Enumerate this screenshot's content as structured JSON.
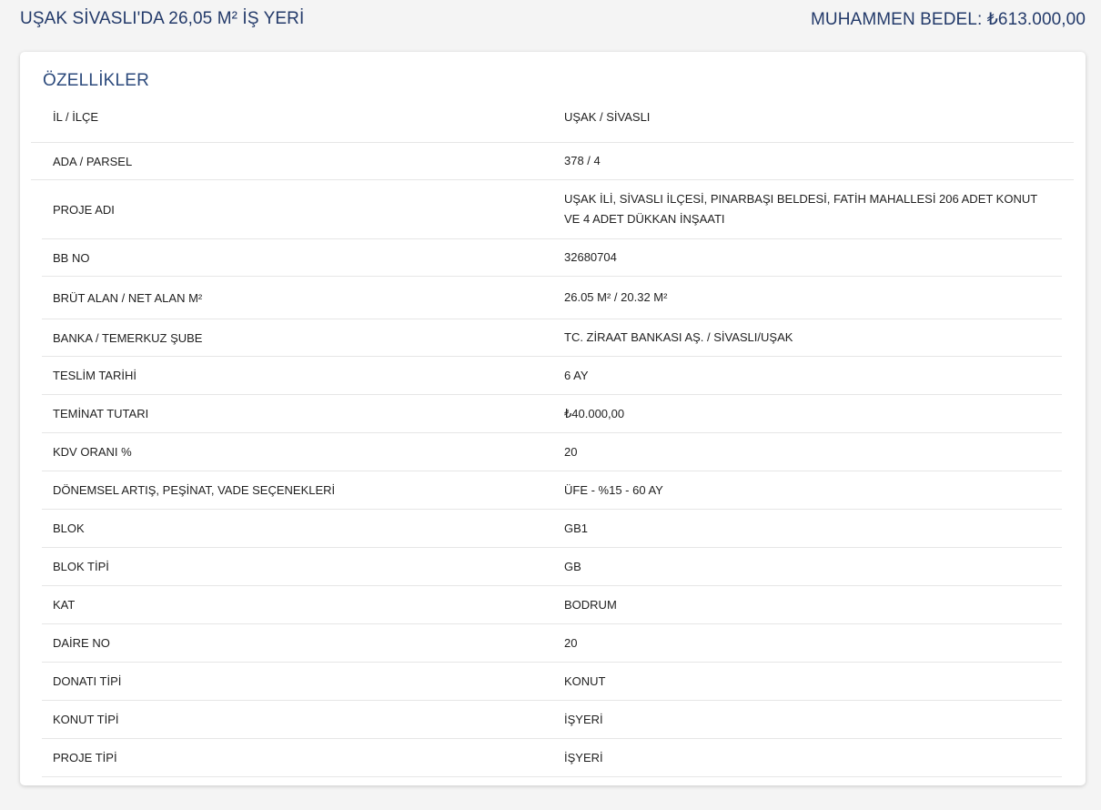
{
  "header": {
    "title": "UŞAK SİVASLI'DA 26,05 M² İŞ YERİ",
    "price": "MUHAMMEN BEDEL: ₺613.000,00"
  },
  "section": {
    "title": "ÖZELLİKLER"
  },
  "properties": [
    {
      "label": "İL / İLÇE",
      "value": "UŞAK / SİVASLI"
    },
    {
      "label": "ADA / PARSEL",
      "value": "378 / 4"
    },
    {
      "label": "PROJE ADI",
      "value": "UŞAK İLİ, SİVASLI İLÇESİ, PINARBAŞI BELDESİ, FATİH MAHALLESİ 206 ADET KONUT VE 4 ADET DÜKKAN İNŞAATI"
    },
    {
      "label": "BB NO",
      "value": "32680704"
    },
    {
      "label": "BRÜT ALAN / NET ALAN M²",
      "value": "26.05 M² / 20.32 M²"
    },
    {
      "label": "BANKA / TEMERKUZ ŞUBE",
      "value": "TC. ZİRAAT BANKASI AŞ. / SİVASLI/UŞAK"
    },
    {
      "label": "TESLİM TARİHİ",
      "value": "6 AY"
    },
    {
      "label": "TEMİNAT TUTARI",
      "value": "₺40.000,00"
    },
    {
      "label": "KDV ORANI %",
      "value": "20"
    },
    {
      "label": "DÖNEMSEL ARTIŞ, PEŞİNAT, VADE SEÇENEKLERİ",
      "value": "ÜFE - %15 - 60 AY"
    },
    {
      "label": "BLOK",
      "value": "GB1"
    },
    {
      "label": "BLOK TİPİ",
      "value": "GB"
    },
    {
      "label": "KAT",
      "value": "BODRUM"
    },
    {
      "label": "DAİRE NO",
      "value": "20"
    },
    {
      "label": "DONATI TİPİ",
      "value": "KONUT"
    },
    {
      "label": "KONUT TİPİ",
      "value": "İŞYERİ"
    },
    {
      "label": "PROJE TİPİ",
      "value": "İŞYERİ"
    }
  ]
}
